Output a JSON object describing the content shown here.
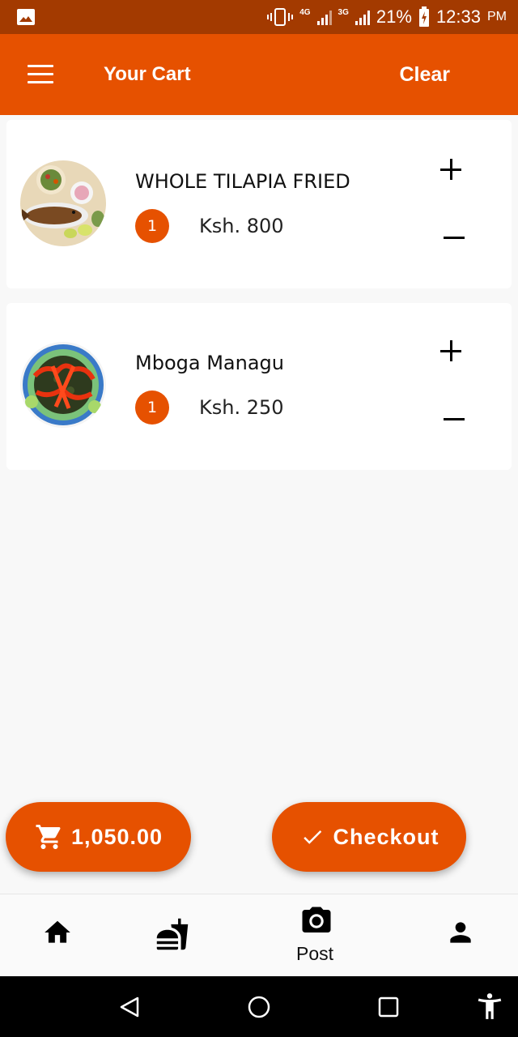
{
  "status_bar": {
    "network_4g": "4G",
    "network_3g": "3G",
    "battery": "21%",
    "time": "12:33",
    "ampm": "PM"
  },
  "app_bar": {
    "title": "Your Cart",
    "clear_label": "Clear",
    "icons": [
      "menu-icon"
    ]
  },
  "cart": {
    "items": [
      {
        "name": "WHOLE TILAPIA FRIED",
        "quantity": "1",
        "price": "Ksh. 800",
        "image": "tilapia-dish"
      },
      {
        "name": "Mboga Managu",
        "quantity": "1",
        "price": "Ksh. 250",
        "image": "managu-dish"
      }
    ]
  },
  "actions": {
    "total": "1,050.00",
    "checkout_label": "Checkout",
    "icons": [
      "cart-icon",
      "check-icon"
    ]
  },
  "bottom_nav": {
    "items": [
      {
        "icon": "home-icon",
        "label": ""
      },
      {
        "icon": "fastfood-icon",
        "label": ""
      },
      {
        "icon": "camera-icon",
        "label": "Post"
      },
      {
        "icon": "person-icon",
        "label": ""
      }
    ]
  },
  "colors": {
    "primary": "#e65100",
    "status_bar": "#a33a00",
    "background": "#f8f8f8"
  }
}
